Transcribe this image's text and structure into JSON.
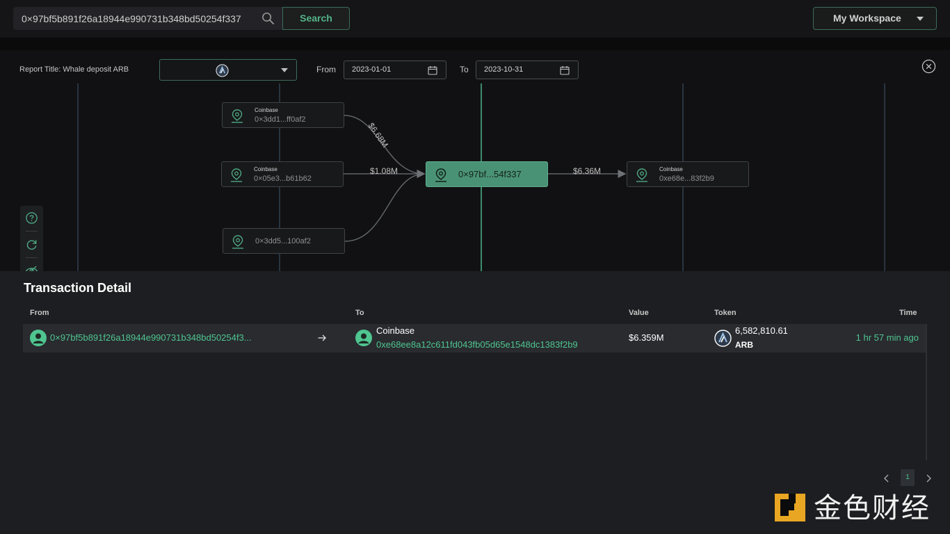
{
  "search": {
    "value": "0×97bf5b891f26a18944e990731b348bd50254f337",
    "button_label": "Search"
  },
  "workspace": {
    "label": "My Workspace"
  },
  "report": {
    "title": "Report Title: Whale deposit ARB",
    "token_icon": "arbitrum-icon",
    "from_label": "From",
    "from_date": "2023-01-01",
    "to_label": "To",
    "to_date": "2023-10-31"
  },
  "graph": {
    "nodes": [
      {
        "id": "n1",
        "label": "Coinbase",
        "address": "0×3dd1...ff0af2"
      },
      {
        "id": "n2",
        "label": "Coinbase",
        "address": "0×05e3...b61b62"
      },
      {
        "id": "n3",
        "label": "",
        "address": "0×3dd5...100af2"
      },
      {
        "id": "center",
        "label": "",
        "address": "0×97bf...54f337"
      },
      {
        "id": "n4",
        "label": "Coinbase",
        "address": "0xe68e...83f2b9"
      }
    ],
    "edges": [
      {
        "from": "n1",
        "to": "center",
        "label": "$6.68M"
      },
      {
        "from": "n2",
        "to": "center",
        "label": "$1.08M"
      },
      {
        "from": "n3",
        "to": "center",
        "label": ""
      },
      {
        "from": "center",
        "to": "n4",
        "label": "$6.36M"
      }
    ],
    "toolbar_icons": [
      "help-icon",
      "refresh-icon",
      "hide-icon"
    ],
    "colors": {
      "accent": "#4fc590",
      "center_node": "#4a9276",
      "grid_line": "#2a3440"
    }
  },
  "detail": {
    "title": "Transaction Detail",
    "columns": {
      "from": "From",
      "to": "To",
      "value": "Value",
      "token": "Token",
      "time": "Time"
    },
    "rows": [
      {
        "from_address": "0×97bf5b891f26a18944e990731b348bd50254f3...",
        "to_label": "Coinbase",
        "to_address": "0xe68ee8a12c611fd043fb05d65e1548dc1383f2b9",
        "value": "$6.359M",
        "token_amount": "6,582,810.61",
        "token_symbol": "ARB",
        "time": "1 hr 57 min ago"
      }
    ],
    "pagination": {
      "current_page": "1"
    }
  },
  "watermark": {
    "text": "金色财经"
  }
}
